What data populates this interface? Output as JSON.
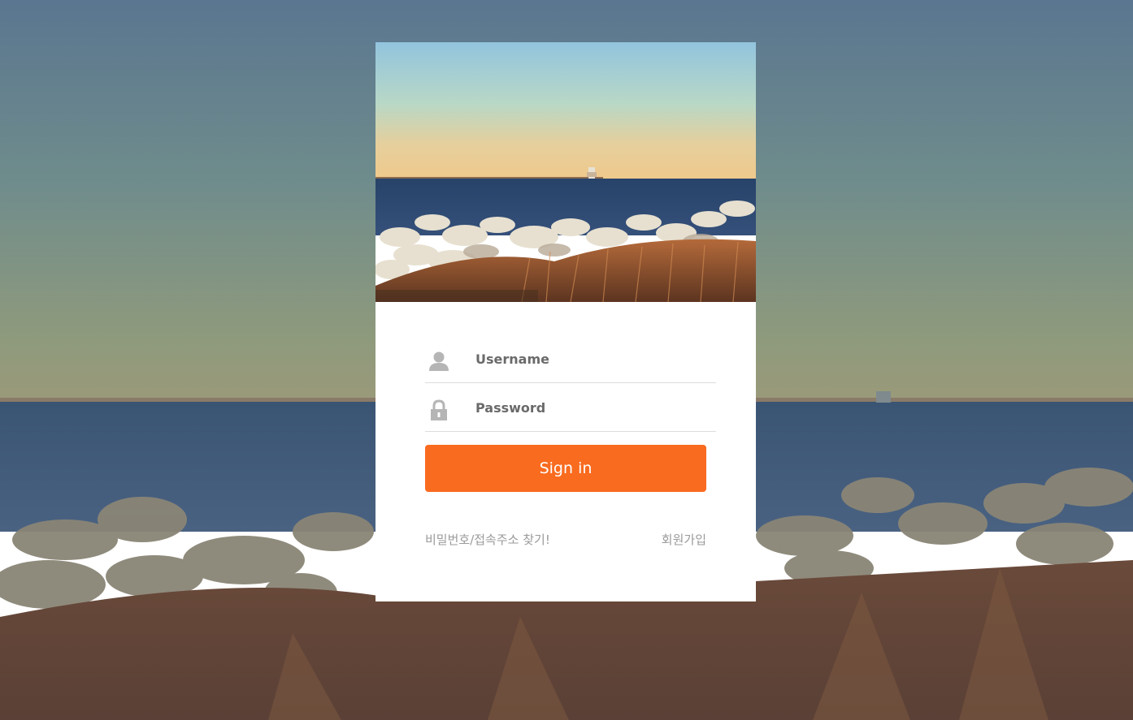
{
  "login": {
    "username_placeholder": "Username",
    "password_placeholder": "Password",
    "signin_label": "Sign in",
    "find_password_link": "비밀번호/접속주소 찾기!",
    "signup_link": "회원가입"
  },
  "colors": {
    "accent": "#f96b1f",
    "link": "#9a9a9a",
    "icon": "#b5b5b5",
    "divider": "#dcdcdc"
  },
  "icons": {
    "username": "user-icon",
    "password": "lock-icon"
  }
}
